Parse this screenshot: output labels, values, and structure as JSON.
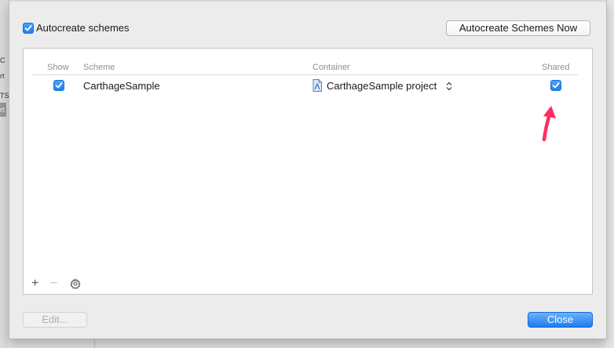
{
  "background": {
    "left_glyphs": [
      "C",
      "rt",
      "TS",
      "rt"
    ]
  },
  "sheet": {
    "autocreate_checkbox": {
      "label": "Autocreate schemes",
      "checked": true
    },
    "autocreate_now_button": "Autocreate Schemes Now",
    "table": {
      "columns": [
        "Show",
        "Scheme",
        "Container",
        "Shared"
      ],
      "rows": [
        {
          "show": true,
          "scheme": "CarthageSample",
          "container": "CarthageSample project",
          "shared": true
        }
      ]
    },
    "toolbar": {
      "add": "+",
      "remove": "−",
      "gear_icon": "gear-icon"
    },
    "edit_button": "Edit...",
    "close_button": "Close"
  },
  "annotation": {
    "arrow_color": "#ff2d62"
  },
  "colors": {
    "accent": "#1f7ef0"
  }
}
